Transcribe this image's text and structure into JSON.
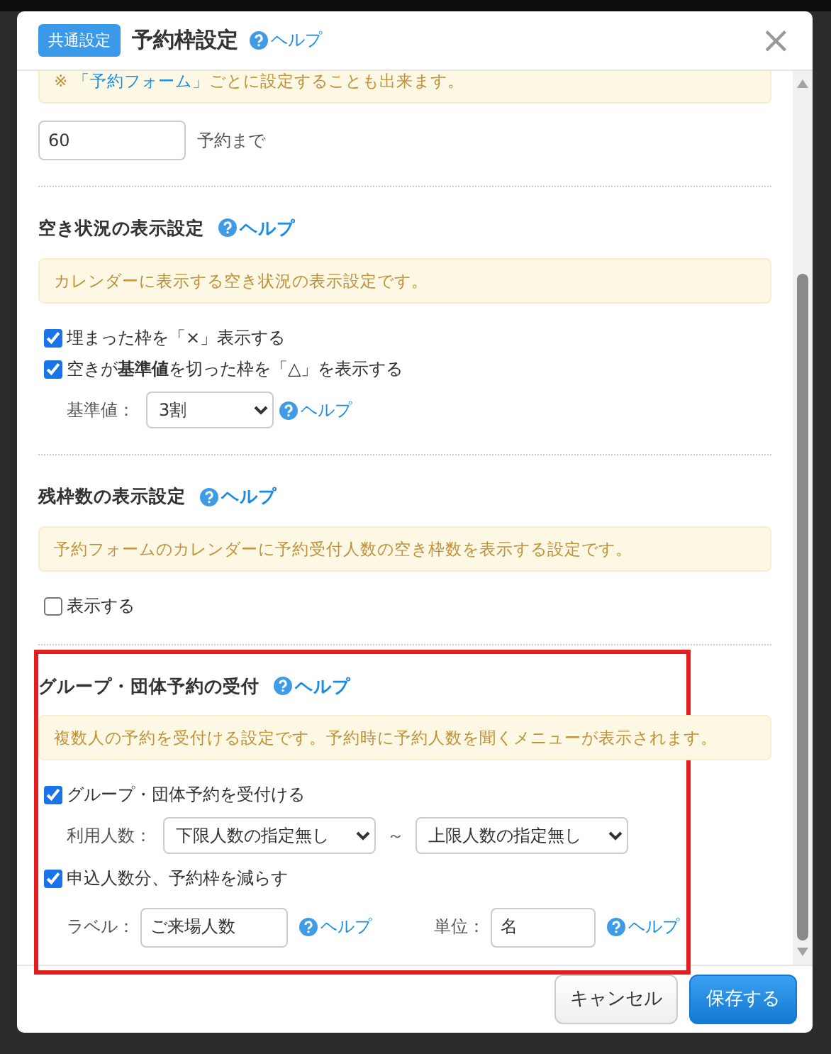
{
  "highlight_frame": true,
  "modal": {
    "badge": "共通設定",
    "title": "予約枠設定",
    "help": "ヘルプ",
    "close": "×"
  },
  "limit": {
    "note_mark": "※",
    "note_link": "「予約フォーム」",
    "note_rest": "ごとに設定することも出来ます。",
    "value": "60",
    "suffix": "予約まで"
  },
  "sections": [
    {
      "heading": "空き状況の表示設定",
      "help": "ヘルプ",
      "note": "カレンダーに表示する空き状況の表示設定です。",
      "rows": [
        {
          "kind": "check",
          "label": "埋まった枠を「×」表示する",
          "checked": true
        },
        {
          "kind": "check",
          "label": "空きが**基準値**を切った枠を「△」を表示する",
          "checked": true
        },
        {
          "kind": "select",
          "label": "基準値：",
          "value": "3割",
          "help": "ヘルプ"
        }
      ]
    },
    {
      "heading": "残枠数の表示設定",
      "help": "ヘルプ",
      "note": "予約フォームのカレンダーに予約受付人数の空き枠数を表示する設定です。",
      "rows": [
        {
          "kind": "check",
          "label": "表示する",
          "checked": false
        }
      ]
    },
    {
      "heading": "グループ・団体予約の受付",
      "help": "ヘルプ",
      "note": "複数人の予約を受付ける設定です。予約時に予約人数を聞くメニューが表示されます。",
      "rows": [
        {
          "kind": "check",
          "label": "グループ・団体予約を受付ける",
          "checked": true
        },
        {
          "kind": "range",
          "label": "利用人数：",
          "from": "下限人数の指定無し",
          "sep": "～",
          "to": "上限人数の指定無し"
        },
        {
          "kind": "check",
          "label": "申込人数分、予約枠を減らす",
          "checked": true
        },
        {
          "kind": "fields",
          "label": "ラベル：",
          "value": "ご来場人数",
          "help": "ヘルプ",
          "label2": "単位：",
          "value2": "名",
          "help2": "ヘルプ"
        }
      ]
    }
  ],
  "footer": {
    "cancel": "キャンセル",
    "save": "保存する"
  }
}
